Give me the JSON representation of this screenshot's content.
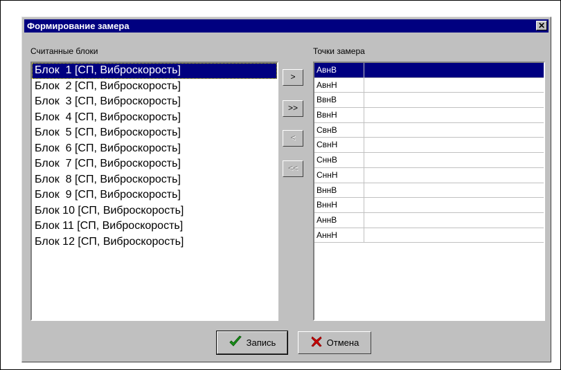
{
  "dialog": {
    "title": "Формирование замера",
    "close_glyph": "✕"
  },
  "left_panel": {
    "label": "Считанные блоки",
    "items": [
      "Блок  1 [СП, Виброскорость]",
      "Блок  2 [СП, Виброскорость]",
      "Блок  3 [СП, Виброскорость]",
      "Блок  4 [СП, Виброскорость]",
      "Блок  5 [СП, Виброскорость]",
      "Блок  6 [СП, Виброскорость]",
      "Блок  7 [СП, Виброскорость]",
      "Блок  8 [СП, Виброскорость]",
      "Блок  9 [СП, Виброскорость]",
      "Блок 10 [СП, Виброскорость]",
      "Блок 11 [СП, Виброскорость]",
      "Блок 12 [СП, Виброскорость]"
    ],
    "selected_index": 0
  },
  "right_panel": {
    "label": "Точки замера",
    "rows": [
      "АвнВ",
      "АвнН",
      "ВвнВ",
      "ВвнН",
      "СвнВ",
      "СвнН",
      "СннВ",
      "СннН",
      "ВннВ",
      "ВннН",
      "АннВ",
      "АннН"
    ],
    "selected_index": 0
  },
  "move_buttons": {
    "add_one": ">",
    "add_all": ">>",
    "remove_one": "<",
    "remove_all": "<<"
  },
  "footer": {
    "save_label": "Запись",
    "cancel_label": "Отмена"
  },
  "colors": {
    "selection": "#000080",
    "save_icon": "#1a9a1a",
    "cancel_icon": "#cc0000"
  }
}
